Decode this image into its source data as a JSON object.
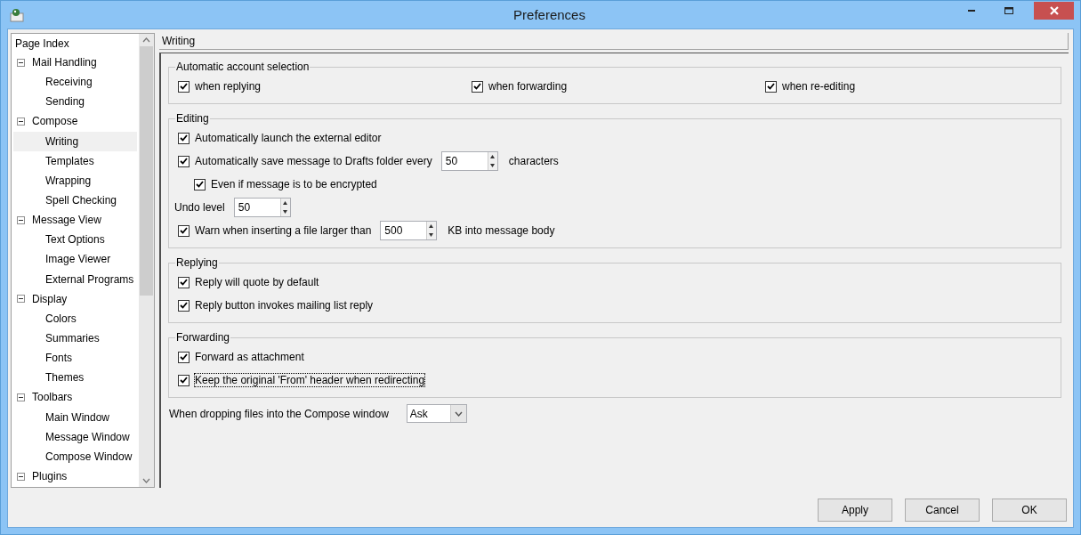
{
  "window": {
    "title": "Preferences"
  },
  "sidebar": {
    "header": "Page Index",
    "items": [
      {
        "label": "Mail Handling",
        "expanded": true,
        "selected": false,
        "children": [
          {
            "label": "Receiving",
            "selected": false
          },
          {
            "label": "Sending",
            "selected": false
          }
        ]
      },
      {
        "label": "Compose",
        "expanded": true,
        "selected": false,
        "children": [
          {
            "label": "Writing",
            "selected": true
          },
          {
            "label": "Templates",
            "selected": false
          },
          {
            "label": "Wrapping",
            "selected": false
          },
          {
            "label": "Spell Checking",
            "selected": false
          }
        ]
      },
      {
        "label": "Message View",
        "expanded": true,
        "selected": false,
        "children": [
          {
            "label": "Text Options",
            "selected": false
          },
          {
            "label": "Image Viewer",
            "selected": false
          },
          {
            "label": "External Programs",
            "selected": false
          }
        ]
      },
      {
        "label": "Display",
        "expanded": true,
        "selected": false,
        "children": [
          {
            "label": "Colors",
            "selected": false
          },
          {
            "label": "Summaries",
            "selected": false
          },
          {
            "label": "Fonts",
            "selected": false
          },
          {
            "label": "Themes",
            "selected": false
          }
        ]
      },
      {
        "label": "Toolbars",
        "expanded": true,
        "selected": false,
        "children": [
          {
            "label": "Main Window",
            "selected": false
          },
          {
            "label": "Message Window",
            "selected": false
          },
          {
            "label": "Compose Window",
            "selected": false
          }
        ]
      },
      {
        "label": "Plugins",
        "expanded": true,
        "selected": false
      }
    ]
  },
  "page": {
    "title": "Writing",
    "groups": [
      {
        "title": "Automatic account selection",
        "kind": "inline",
        "rows": [
          {
            "kind": "checkbox",
            "label": "when replying",
            "checked": true
          },
          {
            "kind": "checkbox",
            "label": "when forwarding",
            "checked": true
          },
          {
            "kind": "checkbox",
            "label": "when re-editing",
            "checked": true
          }
        ]
      },
      {
        "title": "Editing",
        "kind": "stacked",
        "rows": [
          {
            "kind": "checkbox",
            "label": "Automatically launch the external editor",
            "checked": true
          },
          {
            "kind": "checkbox_spin",
            "label": "Automatically save message to Drafts folder every",
            "checked": true,
            "value": "50",
            "suffix": "characters",
            "children": [
              {
                "kind": "checkbox",
                "label": "Even if message is to be encrypted",
                "checked": true
              }
            ]
          },
          {
            "kind": "spin",
            "label": "Undo level",
            "value": "50"
          },
          {
            "kind": "checkbox_spin",
            "label": "Warn when inserting a file larger than",
            "checked": true,
            "value": "500",
            "suffix": "KB into message body"
          }
        ]
      },
      {
        "title": "Replying",
        "kind": "stacked",
        "rows": [
          {
            "kind": "checkbox",
            "label": "Reply will quote by default",
            "checked": true
          },
          {
            "kind": "checkbox",
            "label": "Reply button invokes mailing list reply",
            "checked": true
          }
        ]
      },
      {
        "title": "Forwarding",
        "kind": "stacked",
        "rows": [
          {
            "kind": "checkbox",
            "label": "Forward as attachment",
            "checked": true
          },
          {
            "kind": "checkbox",
            "label": "Keep the original 'From' header when redirecting",
            "checked": true,
            "focused": true
          }
        ]
      }
    ],
    "drop_option": {
      "label": "When dropping files into the Compose window",
      "value": "Ask"
    }
  },
  "buttons": [
    "Apply",
    "Cancel",
    "OK"
  ]
}
